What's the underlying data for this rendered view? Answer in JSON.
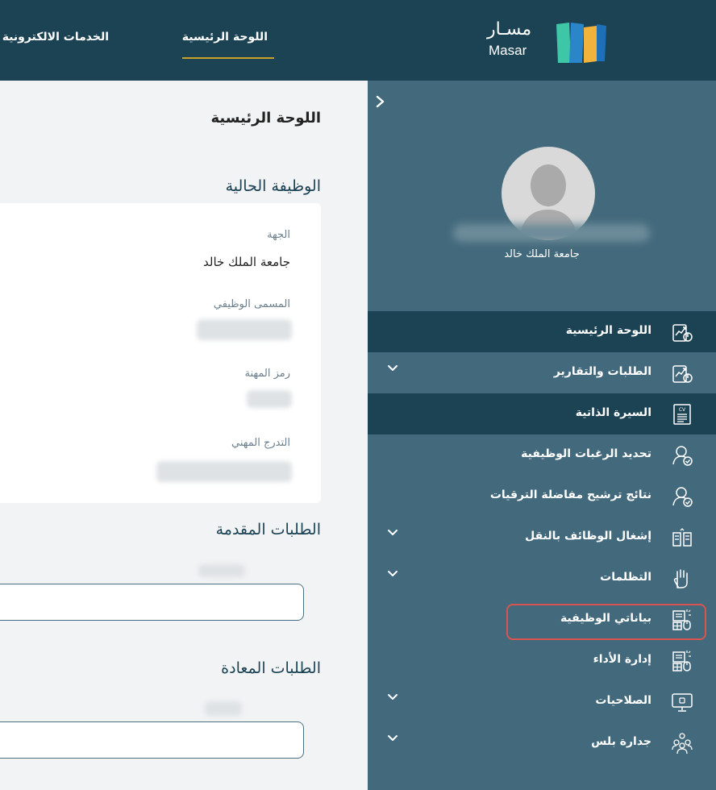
{
  "header": {
    "logo_arabic": "مسـار",
    "logo_latin": "Masar",
    "nav": [
      {
        "label": "الخدمات الالكترونية"
      },
      {
        "label": "اللوحة الرئيسية",
        "active": true
      }
    ],
    "colors": {
      "bar": "#1c4354",
      "active_underline": "#c9a227"
    }
  },
  "main": {
    "page_title": "اللوحة الرئيسية",
    "current_job": {
      "title": "الوظيفة الحالية",
      "fields": [
        {
          "label": "الجهة",
          "value": "جامعة الملك خالد"
        },
        {
          "label": "المسمى الوظيفي",
          "value": ""
        },
        {
          "label": "رمز المهنة",
          "value": ""
        },
        {
          "label": "التدرج المهني",
          "value": ""
        }
      ]
    },
    "submitted_requests": {
      "title": "الطلبات المقدمة"
    },
    "returned_requests": {
      "title": "الطلبات المعادة"
    }
  },
  "sidebar": {
    "user": {
      "organization": "جامعة الملك خالد"
    },
    "menu": [
      {
        "label": "اللوحة الرئيسية",
        "icon": "dashboard-chart-icon",
        "has_submenu": false,
        "active": true
      },
      {
        "label": "الطلبات والتقارير",
        "icon": "reports-chart-icon",
        "has_submenu": true
      },
      {
        "label": "السيرة الذاتية",
        "icon": "cv-document-icon",
        "has_submenu": false,
        "active": true
      },
      {
        "label": "تحديد الرغبات الوظيفية",
        "icon": "user-check-icon",
        "has_submenu": false
      },
      {
        "label": "نتائج ترشيح مفاضلة الترقيات",
        "icon": "user-check-icon",
        "has_submenu": false
      },
      {
        "label": "إشغال الوظائف بالنقل",
        "icon": "building-transfer-icon",
        "has_submenu": true
      },
      {
        "label": "التظلمات",
        "icon": "hand-icon",
        "has_submenu": true
      },
      {
        "label": "بياناتي الوظيفية",
        "icon": "job-data-icon",
        "has_submenu": false,
        "highlighted": true
      },
      {
        "label": "إدارة الأداء",
        "icon": "performance-icon",
        "has_submenu": false
      },
      {
        "label": "الصلاحيات",
        "icon": "monitor-permissions-icon",
        "has_submenu": true
      },
      {
        "label": "جدارة بلس",
        "icon": "group-people-icon",
        "has_submenu": true
      }
    ],
    "colors": {
      "background": "#436a7c",
      "active_item": "#1c4354",
      "highlight_frame": "#d9534f"
    }
  }
}
